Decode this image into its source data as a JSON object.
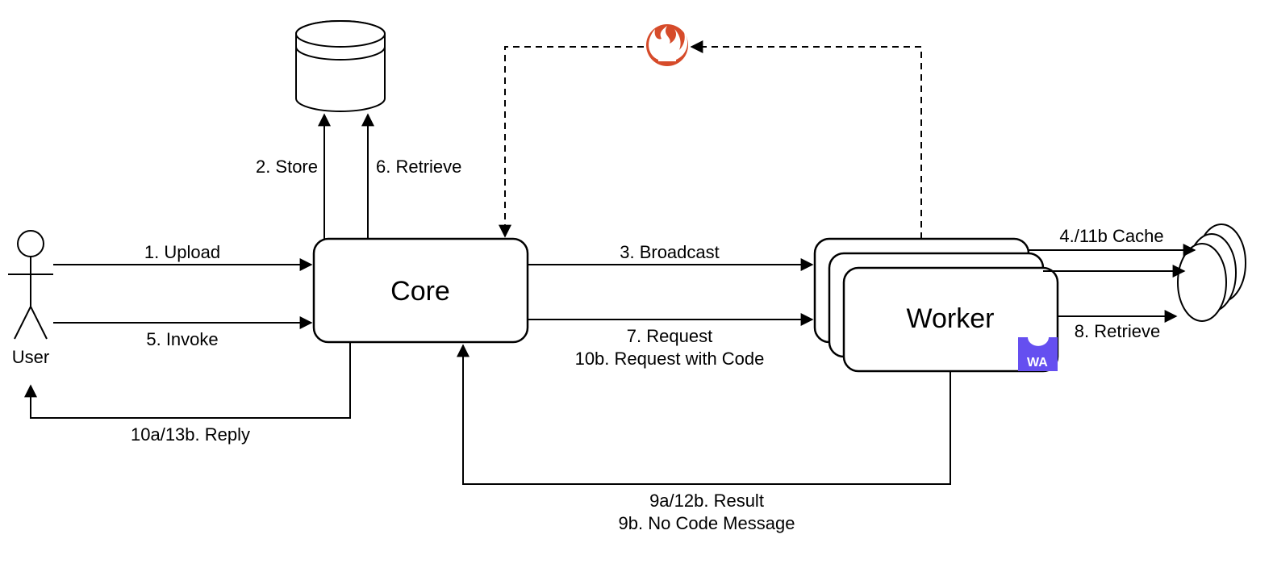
{
  "nodes": {
    "user": "User",
    "core": "Core",
    "worker": "Worker",
    "wa_badge": "WA"
  },
  "edges": {
    "upload": "1. Upload",
    "store": "2. Store",
    "broadcast": "3. Broadcast",
    "cache": "4./11b Cache",
    "invoke": "5. Invoke",
    "retrieve6": "6. Retrieve",
    "request": "7. Request",
    "retrieve8": "8. Retrieve",
    "result": "9a/12b. Result",
    "nocode": "9b. No Code Message",
    "reply": "10a/13b. Reply",
    "reqcode": "10b. Request with Code"
  },
  "colors": {
    "flame": "#D64B2A",
    "wa": "#654FF0",
    "stroke": "#000000"
  }
}
